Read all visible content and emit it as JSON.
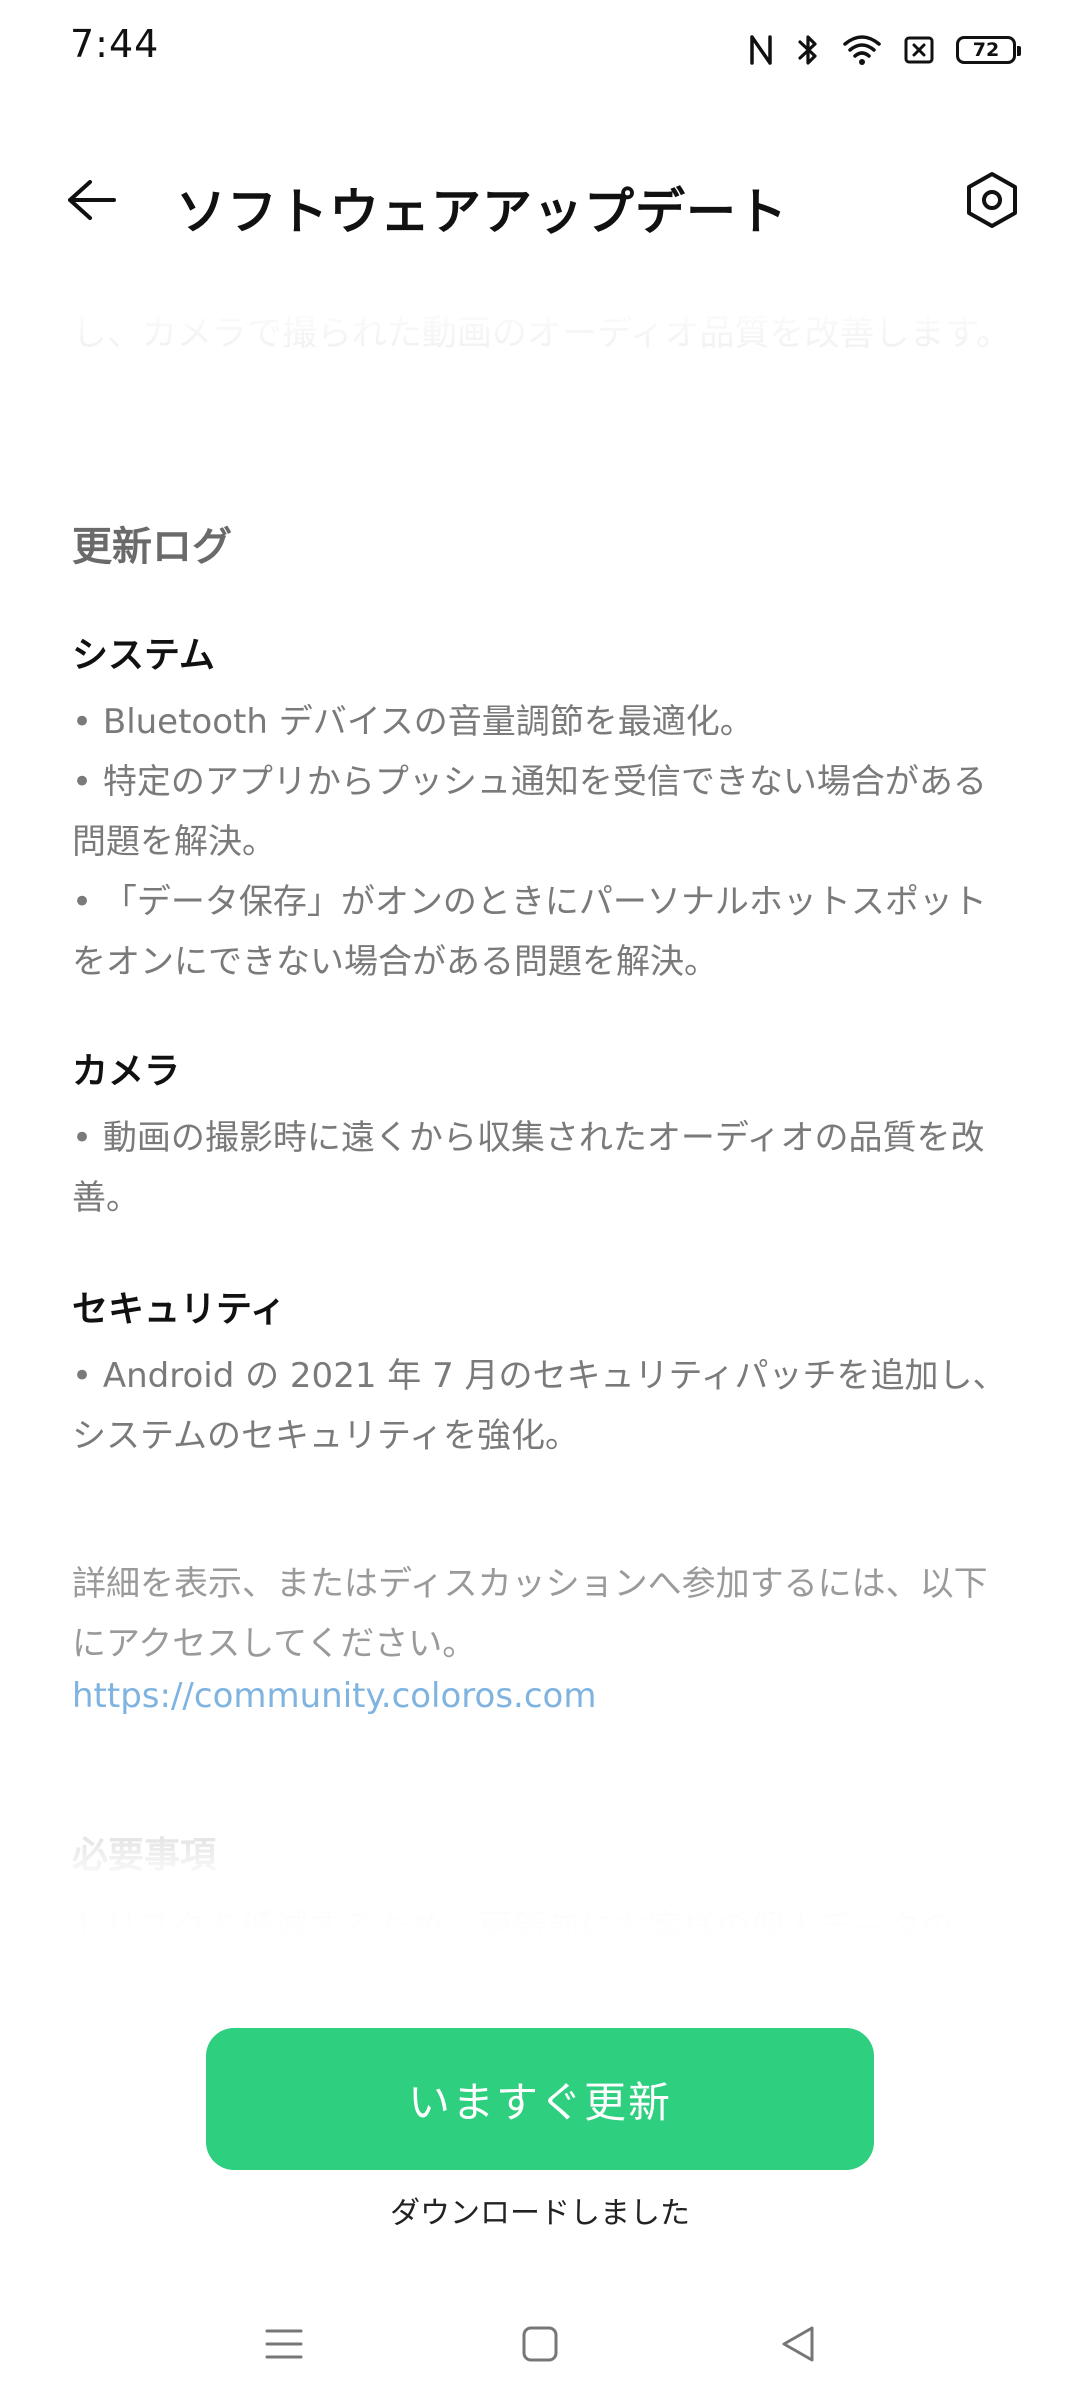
{
  "status_bar": {
    "time": "7:44",
    "battery": "72",
    "icons": [
      "nfc-icon",
      "bluetooth-icon",
      "wifi-icon",
      "sim-off-icon",
      "battery-icon"
    ]
  },
  "app_bar": {
    "title": "ソフトウェアアップデート",
    "back_icon": "back-arrow-icon",
    "settings_icon": "settings-hexagon-icon"
  },
  "content": {
    "intro_text": "し、カメラで撮られた動画のオーディオ品質を改善します。",
    "changelog_title": "更新ログ",
    "system": {
      "heading": "システム",
      "items": [
        "• Bluetooth デバイスの音量調節を最適化。",
        "• 特定のアプリからプッシュ通知を受信できない場合がある問題を解決。",
        "• 「データ保存」がオンのときにパーソナルホットスポットをオンにできない場合がある問題を解決。"
      ]
    },
    "camera": {
      "heading": "カメラ",
      "items": [
        "• 動画の撮影時に遠くから収集されたオーディオの品質を改善。"
      ]
    },
    "security": {
      "heading": "セキュリティ",
      "items": [
        "• Android の 2021 年 7 月のセキュリティパッチを追加し、システムのセキュリティを強化。"
      ]
    },
    "details_text": "詳細を表示、またはディスカッションへ参加するには、以下にアクセスしてください。",
    "details_link": "https://community.coloros.com",
    "requirements_title": "必要事項",
    "requirements_text": "1.リスクを低減するため、更新前にお客様の個人データの"
  },
  "actions": {
    "update_button": "いますぐ更新",
    "download_status": "ダウンロードしました"
  },
  "nav_bar": {
    "icons": [
      "menu-icon",
      "home-icon",
      "back-icon"
    ]
  },
  "colors": {
    "accent": "#2ecf7f",
    "link": "#7fb3e0",
    "body_text": "#7a7a7a"
  }
}
